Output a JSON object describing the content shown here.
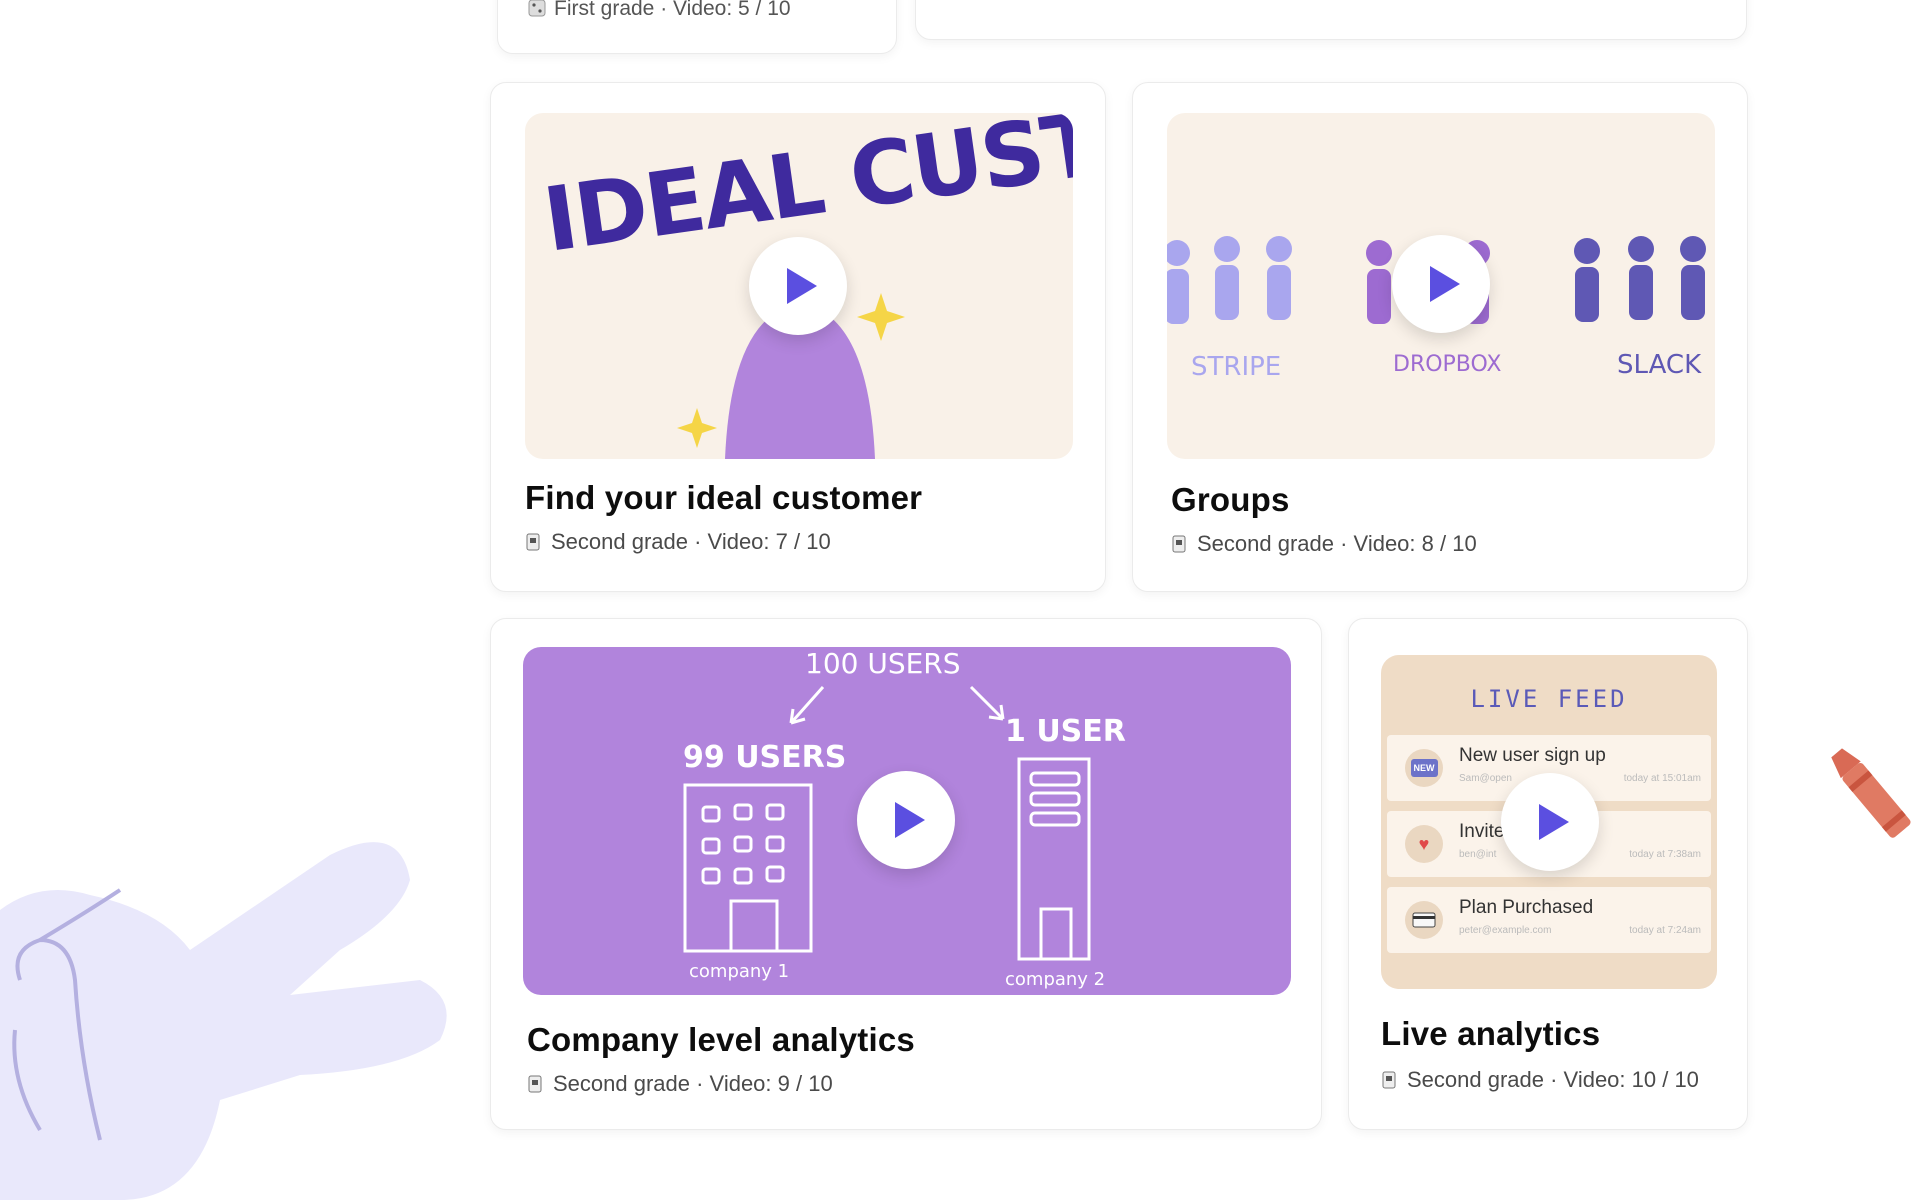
{
  "colors": {
    "play_icon": "#5b4fe0",
    "purple_thumb": "#b184dc",
    "cream_thumb": "#f9f1e8",
    "feed_thumb": "#efdcc6",
    "ink_purple": "#3f2a9e",
    "hand_lavender": "#e9e8fb"
  },
  "top_card": {
    "meta": "First grade · Video: 5 / 10"
  },
  "cards": [
    {
      "title": "Find your ideal customer",
      "meta": "Second grade · Video: 7 / 10",
      "thumb_text": "IDEAL CUSTOMER"
    },
    {
      "title": "Groups",
      "meta": "Second grade · Video: 8 / 10",
      "thumb_labels": [
        "STRIPE",
        "DROPBOX",
        "SLACK"
      ]
    },
    {
      "title": "Company level analytics",
      "meta": "Second grade · Video: 9 / 10",
      "thumb_labels": {
        "top": "100 USERS",
        "left": "99 USERS",
        "right": "1 USER",
        "left_caption": "company 1",
        "right_caption": "company 2"
      }
    },
    {
      "title": "Live analytics",
      "meta": "Second grade · Video: 10 / 10",
      "feed": {
        "title": "LIVE FEED",
        "items": [
          {
            "badge": "NEW",
            "text": "New user sign up",
            "sub": "Sam@open",
            "time": "today at 15:01am"
          },
          {
            "badge": "",
            "text": "Invite",
            "sub": "ben@int",
            "time": "today at 7:38am"
          },
          {
            "badge": "",
            "text": "Plan Purchased",
            "sub": "peter@example.com",
            "time": "today at 7:24am"
          }
        ]
      }
    }
  ]
}
